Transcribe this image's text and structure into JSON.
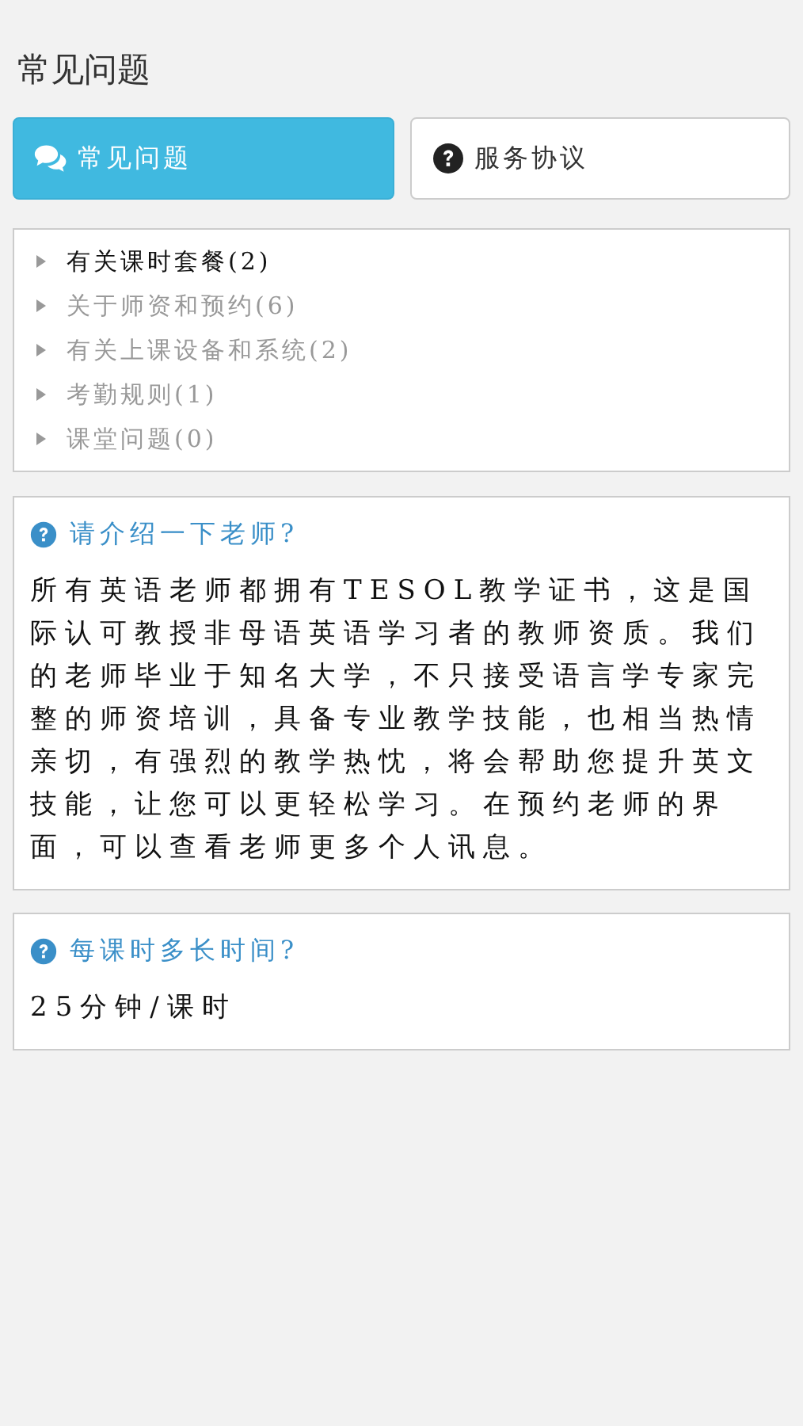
{
  "page_title": "常见问题",
  "tabs": [
    {
      "label": "常见问题",
      "kind": "chat",
      "selected": true
    },
    {
      "label": "服务协议",
      "kind": "question",
      "selected": false
    }
  ],
  "categories": [
    {
      "label": "有关课时套餐(2)",
      "selected": true
    },
    {
      "label": "关于师资和预约(6)",
      "selected": false
    },
    {
      "label": "有关上课设备和系统(2)",
      "selected": false
    },
    {
      "label": "考勤规则(1)",
      "selected": false
    },
    {
      "label": "课堂问题(0)",
      "selected": false
    }
  ],
  "faqs": [
    {
      "question": "请介绍一下老师?",
      "answer": "所有英语老师都拥有TESOL教学证书，这是国际认可教授非母语英语学习者的教师资质。我们的老师毕业于知名大学，不只接受语言学专家完整的师资培训，具备专业教学技能，也相当热情亲切，有强烈的教学热忱，将会帮助您提升英文技能，让您可以更轻松学习。在预约老师的界面，可以查看老师更多个人讯息。"
    },
    {
      "question": "每课时多长时间?",
      "answer": "25分钟/课时"
    }
  ]
}
